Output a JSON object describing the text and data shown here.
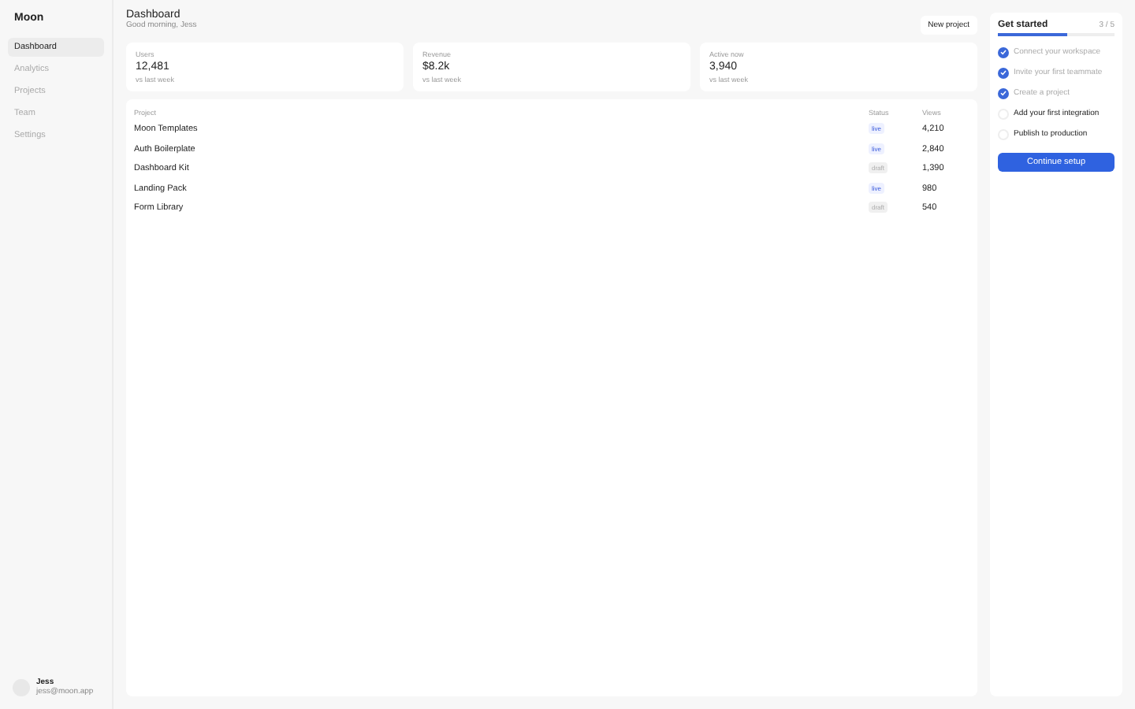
{
  "sidebar": {
    "brand": "Moon",
    "items": [
      {
        "label": "Dashboard",
        "selected": true
      },
      {
        "label": "Analytics",
        "selected": false
      },
      {
        "label": "Projects",
        "selected": false
      },
      {
        "label": "Team",
        "selected": false
      },
      {
        "label": "Settings",
        "selected": false
      }
    ],
    "user": {
      "name": "Jess",
      "email": "jess@moon.app"
    }
  },
  "header": {
    "title": "Dashboard",
    "subtitle": "Good morning, Jess",
    "button": "New project"
  },
  "stats": [
    {
      "label": "Users",
      "value": "12,481",
      "note": "vs last week"
    },
    {
      "label": "Revenue",
      "value": "$8.2k",
      "note": "vs last week"
    },
    {
      "label": "Active now",
      "value": "3,940",
      "note": "vs last week"
    }
  ],
  "table": {
    "columns": [
      "Project",
      "Status",
      "Views"
    ],
    "rows": [
      {
        "project": "Moon Templates",
        "status": "live",
        "kind": "live",
        "views": "4,210"
      },
      {
        "project": "Auth Boilerplate",
        "status": "live",
        "kind": "live",
        "views": "2,840"
      },
      {
        "project": "Dashboard Kit",
        "status": "draft",
        "kind": "draft",
        "views": "1,390"
      },
      {
        "project": "Landing Pack",
        "status": "live",
        "kind": "live",
        "views": "980"
      },
      {
        "project": "Form Library",
        "status": "draft",
        "kind": "draft",
        "views": "540"
      }
    ]
  },
  "checklist": {
    "title": "Get started",
    "count": "3 / 5",
    "level": 0.6,
    "items": [
      {
        "label": "Connect your workspace",
        "checked": true
      },
      {
        "label": "Invite your first teammate",
        "checked": true
      },
      {
        "label": "Create a project",
        "checked": true
      },
      {
        "label": "Add your first integration",
        "checked": false
      },
      {
        "label": "Publish to production",
        "checked": false
      }
    ],
    "button": "Continue setup"
  }
}
